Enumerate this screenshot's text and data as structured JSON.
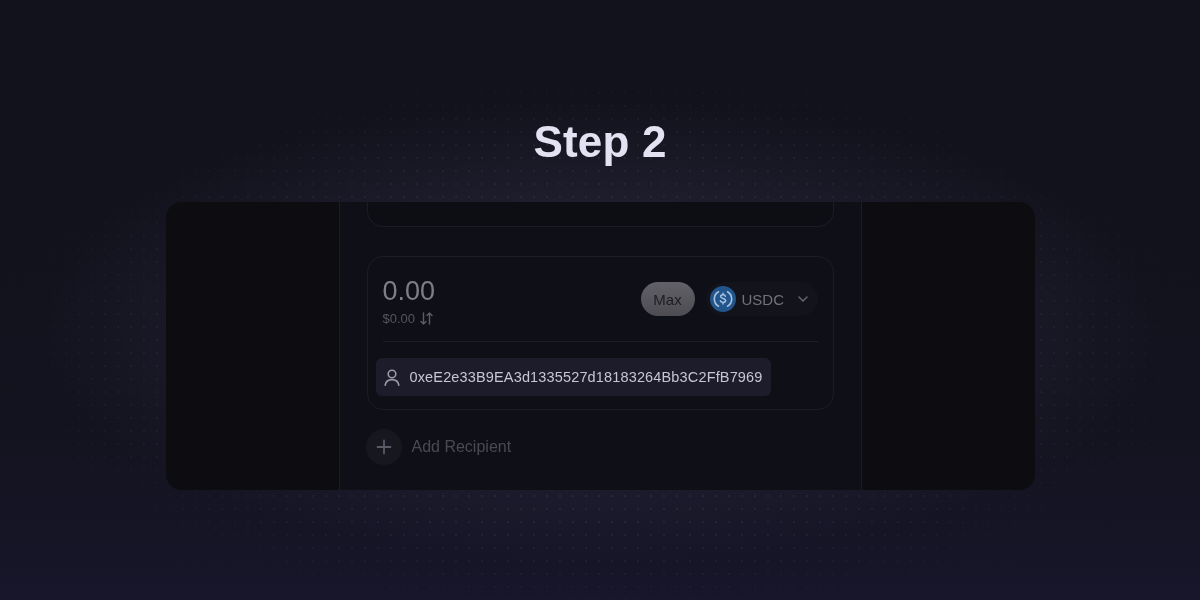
{
  "heading": "Step 2",
  "amount_card": {
    "amount": "0.00",
    "fiat_value": "$0.00",
    "max_button": "Max",
    "token": {
      "symbol": "USDC"
    },
    "recipient": {
      "address": "0xeE2e33B9EA3d1335527d18183264Bb3C2FfB7969"
    }
  },
  "add_recipient": {
    "label": "Add Recipient"
  }
}
